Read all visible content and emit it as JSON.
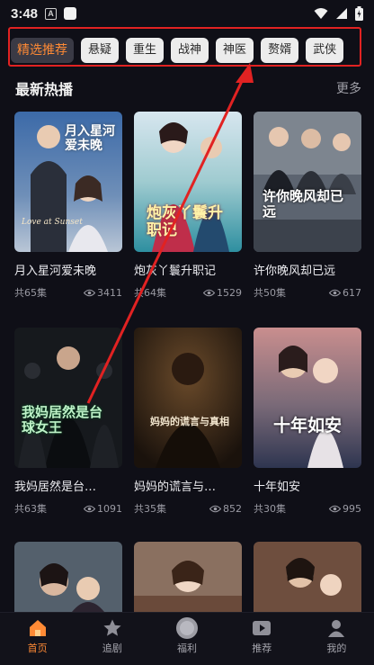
{
  "status": {
    "time": "3:48",
    "a_icon": "A"
  },
  "chips": [
    "精选推荐",
    "悬疑",
    "重生",
    "战神",
    "神医",
    "赘婿",
    "武侠"
  ],
  "section": {
    "title": "最新热播",
    "more": "更多"
  },
  "cards": [
    {
      "title": "月入星河爱未晚",
      "episodes": "共65集",
      "views": "3411"
    },
    {
      "title": "炮灰丫鬟升职记",
      "episodes": "共64集",
      "views": "1529"
    },
    {
      "title": "许你晚风却已远",
      "episodes": "共50集",
      "views": "617"
    },
    {
      "title": "我妈居然是台…",
      "episodes": "共63集",
      "views": "1091"
    },
    {
      "title": "妈妈的谎言与…",
      "episodes": "共35集",
      "views": "852"
    },
    {
      "title": "十年如安",
      "episodes": "共30集",
      "views": "995"
    }
  ],
  "posters": [
    {
      "text": "月入星河爱未晚",
      "sub": "Love at Sunset"
    },
    {
      "text": "炮灰丫鬟升职记"
    },
    {
      "text": "许你晚风却已远"
    },
    {
      "text": "我妈居然是台球女王"
    },
    {
      "text": "妈妈的谎言与真相"
    },
    {
      "text": "十年如安"
    }
  ],
  "tabs": [
    {
      "label": "首页",
      "icon": "home-icon"
    },
    {
      "label": "追剧",
      "icon": "star-icon"
    },
    {
      "label": "福利",
      "icon": "coin-icon"
    },
    {
      "label": "推荐",
      "icon": "play-icon"
    },
    {
      "label": "我的",
      "icon": "user-icon"
    }
  ],
  "colors": {
    "accent": "#ff8a35",
    "annotation": "#e12222",
    "background": "#0f0f17"
  }
}
